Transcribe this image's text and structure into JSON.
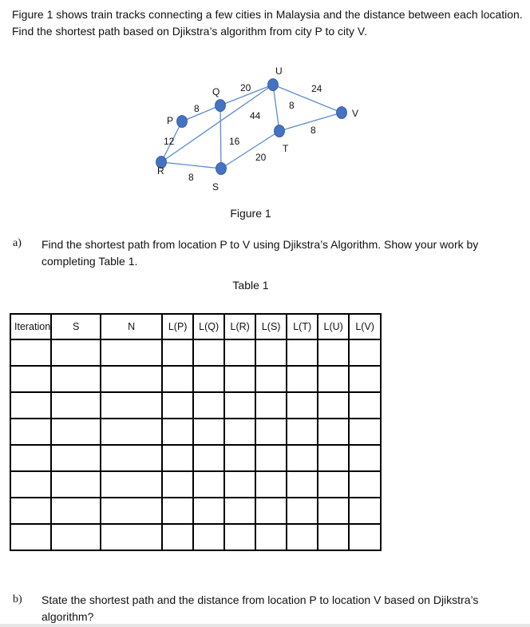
{
  "intro": "Figure 1 shows train tracks connecting a few cities in Malaysia and the distance between each location. Find the shortest path based on Djikstra’s algorithm from city P to city V.",
  "figure": {
    "caption": "Figure 1",
    "node_color": "#4472c4",
    "edge_color": "#5b8bd0",
    "nodes": [
      {
        "id": "P",
        "label": "P"
      },
      {
        "id": "Q",
        "label": "Q"
      },
      {
        "id": "R",
        "label": "R"
      },
      {
        "id": "S",
        "label": "S"
      },
      {
        "id": "T",
        "label": "T"
      },
      {
        "id": "U",
        "label": "U"
      },
      {
        "id": "V",
        "label": "V"
      }
    ],
    "edges": [
      {
        "from": "P",
        "to": "Q",
        "weight": "8"
      },
      {
        "from": "P",
        "to": "R",
        "weight": "12"
      },
      {
        "from": "Q",
        "to": "U",
        "weight": "20"
      },
      {
        "from": "Q",
        "to": "S",
        "weight": "16"
      },
      {
        "from": "R",
        "to": "U",
        "weight": "44"
      },
      {
        "from": "R",
        "to": "S",
        "weight": "8"
      },
      {
        "from": "S",
        "to": "T",
        "weight": "20"
      },
      {
        "from": "U",
        "to": "T",
        "weight": "8"
      },
      {
        "from": "U",
        "to": "V",
        "weight": "24"
      },
      {
        "from": "T",
        "to": "V",
        "weight": "8"
      }
    ]
  },
  "part_a": {
    "label": "a)",
    "text": "Find the shortest path from location P to V using Djikstra’s Algorithm. Show your work by completing Table 1."
  },
  "table": {
    "caption": "Table 1",
    "headers": [
      "Iteration",
      "S",
      "N",
      "L(P)",
      "L(Q)",
      "L(R)",
      "L(S)",
      "L(T)",
      "L(U)",
      "L(V)"
    ],
    "rows": [
      [
        "",
        "",
        "",
        "",
        "",
        "",
        "",
        "",
        "",
        ""
      ],
      [
        "",
        "",
        "",
        "",
        "",
        "",
        "",
        "",
        "",
        ""
      ],
      [
        "",
        "",
        "",
        "",
        "",
        "",
        "",
        "",
        "",
        ""
      ],
      [
        "",
        "",
        "",
        "",
        "",
        "",
        "",
        "",
        "",
        ""
      ],
      [
        "",
        "",
        "",
        "",
        "",
        "",
        "",
        "",
        "",
        ""
      ],
      [
        "",
        "",
        "",
        "",
        "",
        "",
        "",
        "",
        "",
        ""
      ],
      [
        "",
        "",
        "",
        "",
        "",
        "",
        "",
        "",
        "",
        ""
      ],
      [
        "",
        "",
        "",
        "",
        "",
        "",
        "",
        "",
        "",
        ""
      ]
    ]
  },
  "part_b": {
    "label": "b)",
    "text": "State the shortest path and the distance from location P to location V based on Djikstra’s algorithm?"
  }
}
